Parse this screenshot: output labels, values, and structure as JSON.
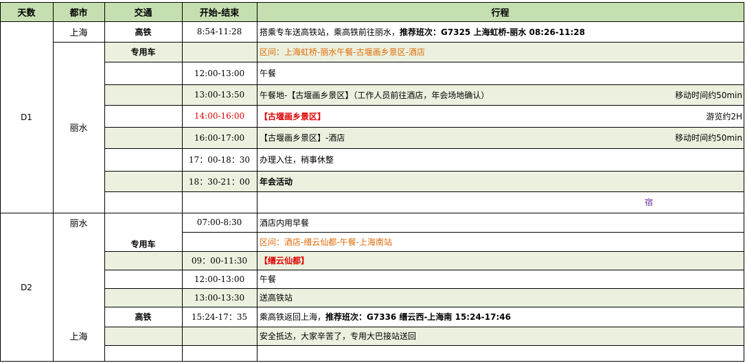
{
  "header": {
    "days": "天数",
    "city": "都市",
    "transport": "交通",
    "time": "开始-结束",
    "itinerary": "行程"
  },
  "d1": {
    "day": "D1",
    "city_shanghai": "上海",
    "city_lishui": "丽水",
    "rows": [
      {
        "transport": "高铁",
        "time": "8:54-11:28",
        "itin_pre": "搭乘专车送高铁站，乘高铁前往丽水，",
        "itin_bold": "推荐班次：G7325 上海虹桥-丽水 08:26-11:28",
        "note": ""
      },
      {
        "transport": "专用车",
        "time": "",
        "itin": "区间：上海虹桥-丽水午餐-古堰画乡景区-酒店",
        "note": ""
      },
      {
        "transport": "",
        "time": "12:00-13:00",
        "itin": "午餐",
        "note": ""
      },
      {
        "transport": "",
        "time": "13:00-13:50",
        "itin": "午餐地-【古堰画乡景区】（工作人员前往酒店，年会场地确认）",
        "note": "移动时间约50min"
      },
      {
        "transport": "",
        "time": "14:00-16:00",
        "itin": "【古堰画乡景区】",
        "note": "游览约2H"
      },
      {
        "transport": "",
        "time": "16:00-17:00",
        "itin": "【古堰画乡景区】-酒店",
        "note": "移动时间约50min"
      },
      {
        "transport": "",
        "time": "17：00-18：30",
        "itin": "办理入住，稍事休整",
        "note": ""
      },
      {
        "transport": "",
        "time": "18：30-21：00",
        "itin": "年会活动",
        "note": ""
      },
      {
        "transport": "",
        "time": "",
        "itin": "宿",
        "note": ""
      }
    ]
  },
  "d2": {
    "day": "D2",
    "city_lishui": "丽水",
    "city_shanghai": "上海",
    "transport_car": "专用车",
    "rows": [
      {
        "transport": "",
        "time": "07:00-8:30",
        "itin": "酒店内用早餐"
      },
      {
        "transport": "",
        "time": "",
        "itin": "区间：酒店-缙云仙都-午餐-上海南站"
      },
      {
        "transport": "",
        "time": "09：00-11:30",
        "itin": "【缙云仙都】"
      },
      {
        "transport": "",
        "time": "12:00-13:00",
        "itin": "午餐"
      },
      {
        "transport": "",
        "time": "13:00-13:30",
        "itin": "送高铁站"
      },
      {
        "transport": "高铁",
        "time": "15:24-17：35",
        "itin_pre": "乘高铁返回上海，",
        "itin_bold": "推荐班次：G7336 缙云西-上海南 15:24-17:46"
      },
      {
        "transport": "",
        "time": "",
        "itin": "安全抵达，大家辛苦了，专用大巴接站送回"
      },
      {
        "transport": "",
        "time": "",
        "itin": ""
      }
    ]
  },
  "colors": {
    "header_bg": "#c6dfb1",
    "alt_row_bg": "#ebf1de",
    "orange_text": "#e26b0a",
    "red_text": "#e00000",
    "purple_text": "#7030a0"
  }
}
